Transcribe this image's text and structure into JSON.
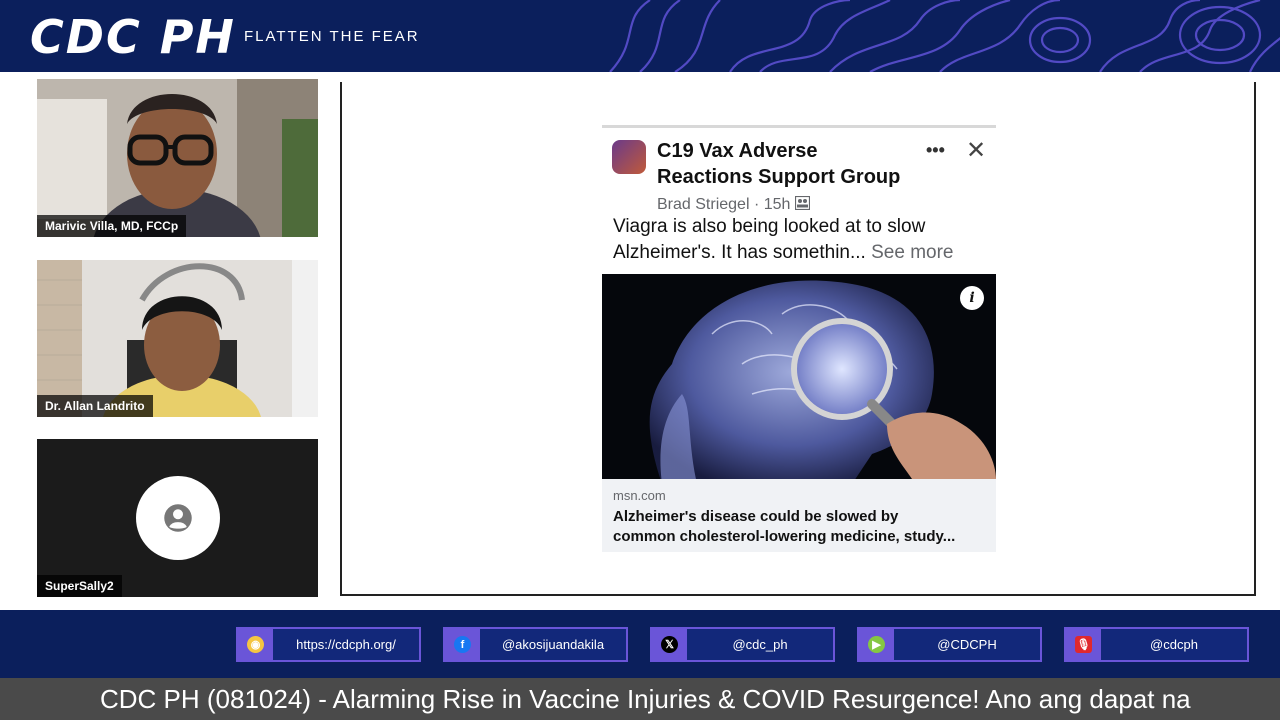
{
  "header": {
    "brand": "CDC PH",
    "tagline": "FLATTEN THE FEAR"
  },
  "participants": [
    {
      "name": "Marivic Villa, MD, FCCp"
    },
    {
      "name": "Dr. Allan Landrito"
    },
    {
      "name": "SuperSally2"
    }
  ],
  "post": {
    "group_line1": "C19 Vax Adverse",
    "group_line2": "Reactions Support Group",
    "author": "Brad Striegel",
    "separator": "·",
    "time": "15h",
    "text_line1": "Viagra is also being looked at to slow",
    "text_line2": "Alzheimer's.  It has somethin...",
    "see_more": "See more",
    "link_domain": "msn.com",
    "link_title_line1": "Alzheimer's disease could be slowed by",
    "link_title_line2": "common cholesterol-lowering medicine, study..."
  },
  "socials": [
    {
      "icon": "website-icon",
      "color": "#f5c542",
      "label": "https://cdcph.org/"
    },
    {
      "icon": "facebook-icon",
      "color": "#1877f2",
      "label": "@akosijuandakila"
    },
    {
      "icon": "x-icon",
      "color": "#000000",
      "label": "@cdc_ph"
    },
    {
      "icon": "rumble-icon",
      "color": "#85c742",
      "label": "@CDCPH"
    },
    {
      "icon": "podcast-icon",
      "color": "#e0282e",
      "label": "@cdcph"
    }
  ],
  "ticker": {
    "text": "CDC PH (081024) - Alarming Rise in Vaccine Injuries & COVID Resurgence! Ano ang dapat na"
  },
  "colors": {
    "navy": "#0b1f5c",
    "accent_purple": "#6a55d8",
    "ticker_gray": "#4a4a4a"
  }
}
